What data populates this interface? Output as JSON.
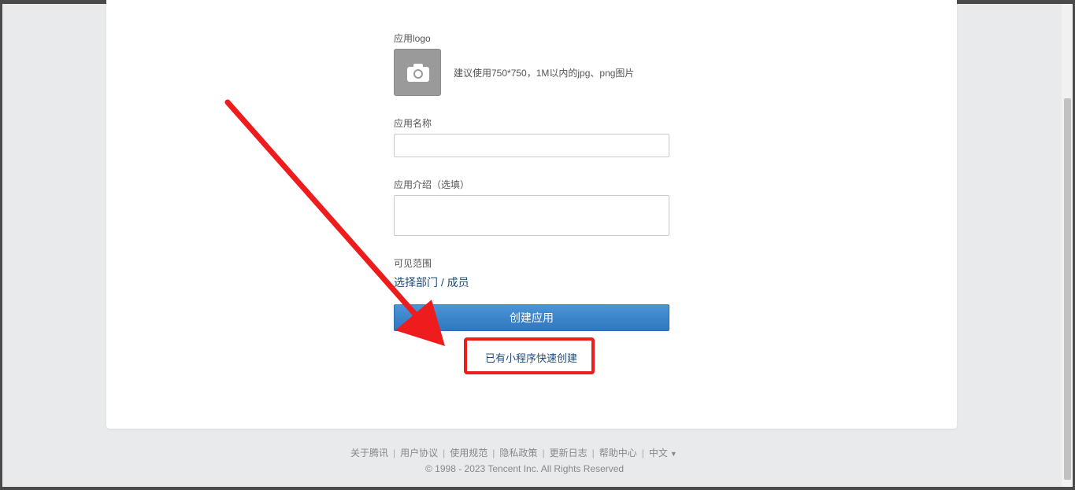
{
  "form": {
    "logo_label": "应用logo",
    "logo_hint": "建议使用750*750，1M以内的jpg、png图片",
    "name_label": "应用名称",
    "name_value": "",
    "intro_label": "应用介绍（选填）",
    "intro_value": "",
    "scope_label": "可见范围",
    "scope_link": "选择部门 / 成员",
    "create_button": "创建应用",
    "quick_create_link": "已有小程序快速创建"
  },
  "footer": {
    "links": [
      "关于腾讯",
      "用户协议",
      "使用规范",
      "隐私政策",
      "更新日志",
      "帮助中心"
    ],
    "language": "中文",
    "copyright": "© 1998 - 2023 Tencent Inc. All Rights Reserved"
  },
  "colors": {
    "accent": "#2f77c0",
    "link": "#1e4b7a",
    "annotation": "#ee1c1c",
    "page_bg": "#e9eaec"
  },
  "icons": {
    "logo_placeholder": "camera-icon",
    "language_dropdown": "caret-down-icon"
  }
}
